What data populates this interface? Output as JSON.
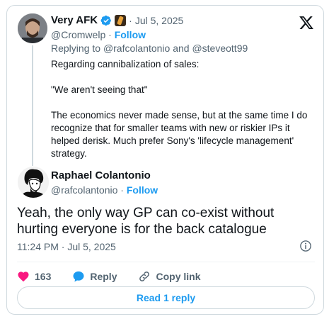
{
  "parent_tweet": {
    "display_name": "Very AFK",
    "date": "Jul 5, 2025",
    "handle": "@Cromwelp",
    "follow_label": "Follow",
    "replying_prefix": "Replying to",
    "replying_to": "@rafcolantonio and @steveott99",
    "paragraphs": [
      "Regarding cannibalization of sales:",
      "\"We aren't seeing that\"",
      "The economics never made sense, but at the same time I do recognize that for smaller teams with new or riskier IPs it helped derisk. Much prefer Sony's 'lifecycle management' strategy."
    ]
  },
  "main_tweet": {
    "display_name": "Raphael Colantonio",
    "handle": "@rafcolantonio",
    "follow_label": "Follow",
    "text": "Yeah, the only way GP can co-exist without hurting everyone is for the back catalogue",
    "timestamp": "11:24 PM · Jul 5, 2025"
  },
  "actions": {
    "like_count": "163",
    "reply_label": "Reply",
    "copy_link_label": "Copy link"
  },
  "read_replies_label": "Read 1 reply",
  "colors": {
    "accent": "#1d9bf0",
    "like": "#f91880",
    "secondary_text": "#536471",
    "border": "#cfd9de"
  },
  "icons": [
    "verified-badge-icon",
    "x-logo-icon",
    "info-icon",
    "heart-icon",
    "reply-bubble-icon",
    "link-icon"
  ]
}
